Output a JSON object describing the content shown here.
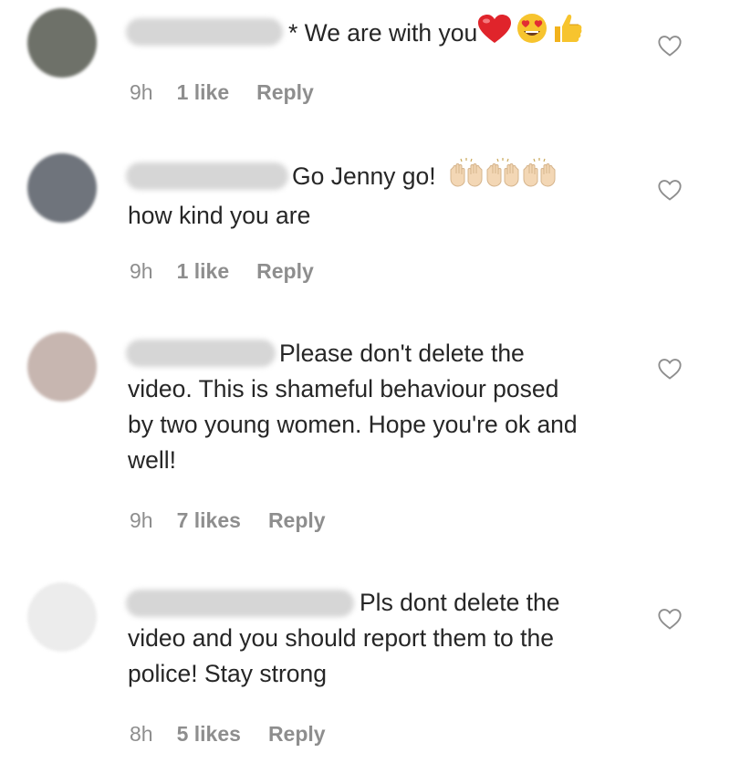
{
  "comments": [
    {
      "text": "* We are with you",
      "emoji": [
        "red-heart",
        "heart-eyes-face",
        "thumbs-up"
      ],
      "time": "9h",
      "likes": "1 like",
      "reply": "Reply",
      "avatar_color": "#6e7169"
    },
    {
      "text": "Go Jenny go!",
      "text_cont": "how kind you are",
      "emoji": [
        "raising-hands",
        "raising-hands",
        "raising-hands"
      ],
      "time": "9h",
      "likes": "1 like",
      "reply": "Reply",
      "avatar_color": "#6f747c"
    },
    {
      "text": "Please don't delete the video. This is shameful behaviour posed by two young women. Hope you're ok and well!",
      "time": "9h",
      "likes": "7 likes",
      "reply": "Reply",
      "avatar_color": "#c7b6b0"
    },
    {
      "text": "Pls dont delete the video and you should report them to the police! Stay strong",
      "time": "8h",
      "likes": "5 likes",
      "reply": "Reply",
      "avatar_color": "#ececec"
    }
  ]
}
